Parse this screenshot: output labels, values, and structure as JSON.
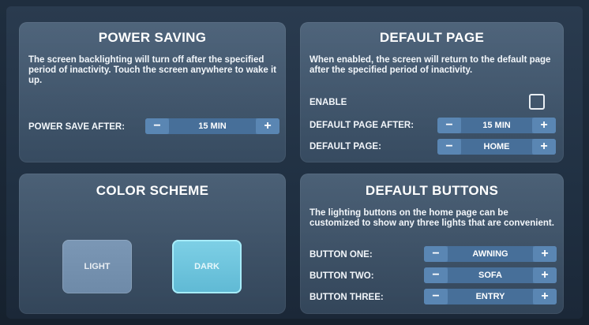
{
  "power_saving": {
    "title": "POWER SAVING",
    "description": "The screen backlighting will turn off after the specified period of inactivity. Touch the screen anywhere to wake it up.",
    "power_save_after_label": "POWER SAVE AFTER:",
    "power_save_after_value": "15 MIN",
    "minus": "−",
    "plus": "+"
  },
  "default_page": {
    "title": "DEFAULT PAGE",
    "description": "When enabled, the screen will return to the default page after the specified period of inactivity.",
    "enable_label": "ENABLE",
    "enable_checked": false,
    "default_page_after_label": "DEFAULT PAGE AFTER:",
    "default_page_after_value": "15 MIN",
    "default_page_label": "DEFAULT PAGE:",
    "default_page_value": "HOME",
    "minus": "−",
    "plus": "+"
  },
  "color_scheme": {
    "title": "COLOR SCHEME",
    "light_label": "LIGHT",
    "dark_label": "DARK",
    "selected": "DARK"
  },
  "default_buttons": {
    "title": "DEFAULT BUTTONS",
    "description": "The lighting buttons on the home page can be customized to show any three lights that are convenient.",
    "button_one_label": "BUTTON ONE:",
    "button_one_value": "AWNING",
    "button_two_label": "BUTTON TWO:",
    "button_two_value": "SOFA",
    "button_three_label": "BUTTON THREE:",
    "button_three_value": "ENTRY",
    "minus": "−",
    "plus": "+"
  }
}
